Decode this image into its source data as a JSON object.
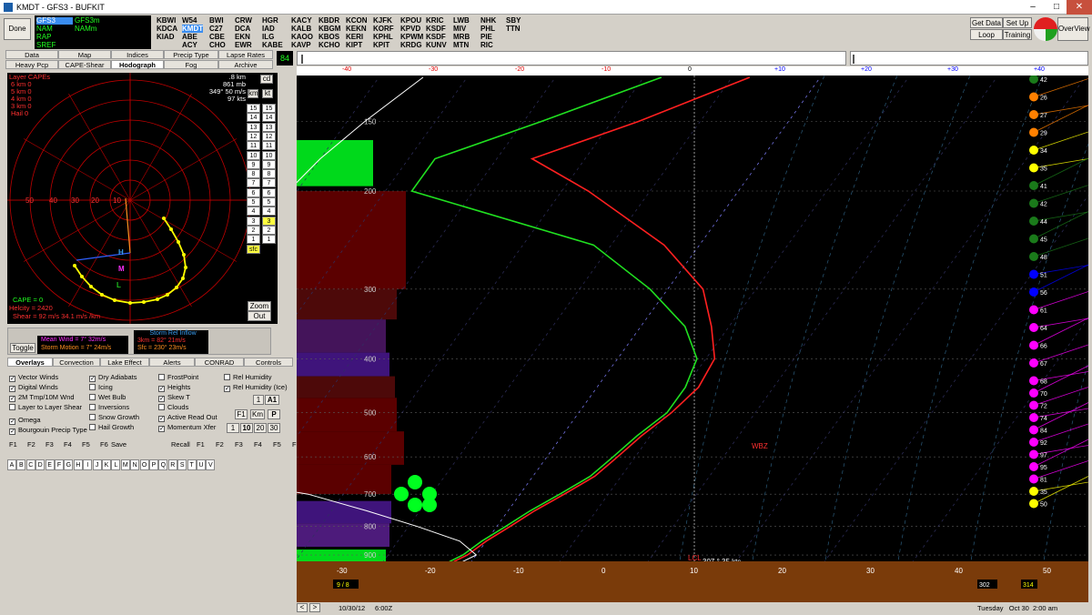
{
  "window": {
    "title": "KMDT - GFS3 - BUFKIT",
    "minimize": "–",
    "maximize": "□",
    "close": "✕"
  },
  "toolbar": {
    "done": "Done",
    "get_data": "Get Data",
    "set_up": "Set Up",
    "loop": "Loop",
    "training": "Training",
    "overview": "OverView"
  },
  "models": {
    "col1": [
      "GFS3",
      "NAM",
      "RAP",
      "SREF"
    ],
    "col2": [
      "GFS3m",
      "NAMm"
    ],
    "selected": "GFS3"
  },
  "stations": {
    "row1": [
      "KBWI",
      "W54",
      "BWI",
      "CRW",
      "HGR",
      "KACY",
      "KBDR",
      "KCON",
      "KJFK",
      "KPOU",
      "KRIC",
      "LWB",
      "NHK",
      "SBY"
    ],
    "row2": [
      "KDCA",
      "KMDT",
      "C27",
      "DCA",
      "IAD",
      "KALB",
      "KBGM",
      "KEKN",
      "KORF",
      "KPVD",
      "KSDF",
      "MIV",
      "PHL",
      "TTN"
    ],
    "row3": [
      "KIAD",
      "ABE",
      "CBE",
      "EKN",
      "ILG",
      "KAOO",
      "KBOS",
      "KERI",
      "KPHL",
      "KPWM",
      "KSDF",
      "MRB",
      "PIE",
      ""
    ],
    "row4": [
      "",
      "ACY",
      "CHO",
      "EWR",
      "KABE",
      "KAVP",
      "KCHO",
      "KIPT",
      "KPIT",
      "KRDG",
      "KUNV",
      "MTN",
      "RIC",
      ""
    ]
  },
  "tabs_row1": [
    "Data",
    "Map",
    "Indices",
    "Precip Type",
    "Lapse Rates"
  ],
  "tabs_row2": [
    "Heavy Pcp",
    "CAPE-Shear",
    "Hodograph",
    "Fog",
    "Archive"
  ],
  "frame_box": "84",
  "hodograph": {
    "layer_capes": [
      "Layer CAPEs",
      "6 km  0",
      "5 km  0",
      "4 km  0",
      "3 km  0",
      "Hail  0"
    ],
    "readout": [
      ".8 km",
      "861 mb",
      "349° 50 m/s",
      "97 kts"
    ],
    "ring_labels": [
      "50",
      "40",
      "30",
      "20",
      "10"
    ],
    "cape": "CAPE = 0",
    "helicity": "Helcity = 2420",
    "shear": "Shear = 92 m/s  34.1 m/s /km",
    "markers": {
      "h": "H",
      "m": "M",
      "l": "L"
    },
    "small_btns": [
      "cd",
      "km",
      "kt"
    ],
    "layers_left": [
      "15",
      "14",
      "13",
      "12",
      "11",
      "10",
      "9",
      "8",
      "7",
      "6",
      "5",
      "4",
      "3",
      "2",
      "1",
      "sfc"
    ],
    "layers_right": [
      "15",
      "14",
      "13",
      "12",
      "11",
      "10",
      "9",
      "8",
      "7",
      "6",
      "5",
      "4",
      "3",
      "2",
      "1"
    ],
    "zoom": "Zoom",
    "out": "Out"
  },
  "storm": {
    "toggle": "Toggle",
    "mean_wind": "Mean Wind = 7°  32m/s",
    "storm_motion": "Storm Motion = 7°  24m/s",
    "rel_inflow_title": "Storm Rel Inflow",
    "rel_3km": "3km = 82°  21m/s",
    "rel_sfc": "Sfc = 230°  23m/s"
  },
  "panel_tabs1": [
    "Overlays",
    "Convection",
    "Lake Effect",
    "Alerts",
    "CONRAD",
    "Controls"
  ],
  "overlays": {
    "col1": [
      "Vector Winds",
      "Digital Winds",
      "2M Tmp/10M Wnd",
      "Layer to Layer Shear",
      "Omega",
      "Bourgouin Precip Type"
    ],
    "col1_checked": [
      true,
      true,
      true,
      false,
      true,
      true
    ],
    "col2": [
      "Dry Adiabats",
      "Icing",
      "Wet Bulb",
      "Inversions",
      "Snow Growth",
      "Hail Growth"
    ],
    "col2_checked": [
      true,
      false,
      false,
      false,
      false,
      false
    ],
    "col3": [
      "FrostPoint",
      "Heights",
      "Skew T",
      "Clouds",
      "Active Read Out",
      "Momentum Xfer"
    ],
    "col3_checked": [
      false,
      true,
      true,
      false,
      true,
      true
    ],
    "col4": [
      "Rel Humidity",
      "Rel Humidity (Ice)"
    ],
    "col4_checked": [
      false,
      true
    ],
    "btns_a": [
      "1",
      "A1"
    ],
    "btns_b": [
      "F1",
      "Km",
      "P"
    ],
    "btns_c": [
      "1",
      "10",
      "20",
      "30"
    ]
  },
  "fkeys_left": [
    "F1",
    "F2",
    "F3",
    "F4",
    "F5",
    "F6"
  ],
  "save": "Save",
  "recall": "Recall",
  "fkeys_right": [
    "F1",
    "F2",
    "F3",
    "F4",
    "F5",
    "F6"
  ],
  "letters": [
    "A",
    "B",
    "C",
    "D",
    "E",
    "F",
    "G",
    "H",
    "I",
    "J",
    "K",
    "L",
    "M",
    "N",
    "O",
    "P",
    "Q",
    "R",
    "S",
    "T",
    "U",
    "V"
  ],
  "skewt": {
    "top_ticks": [
      "-40",
      "-30",
      "-20",
      "-10",
      "0",
      "+10",
      "+20",
      "+30",
      "+40"
    ],
    "pressure_labels": [
      "150",
      "200",
      "300",
      "400",
      "500",
      "600",
      "700",
      "800",
      "900"
    ],
    "bottom_ticks": [
      "-30",
      "-20",
      "-10",
      "0",
      "10",
      "20",
      "30",
      "40",
      "50"
    ],
    "wbz": "WBZ",
    "lcl": "LCL",
    "surface_wind": "307 ° 35 kts",
    "left_box": "9 / 8",
    "right_box": "302",
    "right_box2": "314",
    "wind_speeds": [
      "42",
      "26",
      "27",
      "29",
      "34",
      "35",
      "41",
      "42",
      "44",
      "45",
      "48",
      "51",
      "56",
      "61",
      "64",
      "66",
      "67",
      "68",
      "70",
      "72",
      "74",
      "84",
      "92",
      "97",
      "95",
      "81",
      "35",
      "50"
    ],
    "wind_colors": [
      "#1a7a1a",
      "#ff8000",
      "#ff8000",
      "#ff8000",
      "#ffff00",
      "#ffff00",
      "#1a7a1a",
      "#1a7a1a",
      "#1a7a1a",
      "#1a7a1a",
      "#1a7a1a",
      "#0000ff",
      "#0000ff",
      "#ff00ff",
      "#ff00ff",
      "#ff00ff",
      "#ff00ff",
      "#ff00ff",
      "#ff00ff",
      "#ff00ff",
      "#ff00ff",
      "#ff00ff",
      "#ff00ff",
      "#ff00ff",
      "#ff00ff",
      "#ff00ff",
      "#ffff00",
      "#ffff00"
    ],
    "series": [
      {
        "name": "",
        "color": "#ff2020",
        "p": [
          125,
          150,
          175,
          200,
          250,
          300,
          350,
          400,
          450,
          500,
          550,
          600,
          650,
          700,
          750,
          800,
          850,
          900,
          925
        ],
        "t": [
          -8,
          -17,
          -26,
          -17,
          -4,
          4,
          8,
          11,
          11.5,
          10.5,
          9,
          8,
          7,
          5,
          3,
          1.5,
          0,
          -1,
          -2
        ]
      },
      {
        "name": "",
        "color": "#20e020",
        "p": [
          125,
          150,
          175,
          200,
          250,
          300,
          350,
          400,
          450,
          500,
          550,
          600,
          650,
          700,
          750,
          800,
          850,
          900,
          925
        ],
        "t": [
          -18,
          -28,
          -37,
          -37,
          -12,
          -2,
          5,
          9,
          10,
          10,
          8.5,
          7.5,
          6.5,
          4.5,
          2.5,
          1,
          -0.5,
          -1.5,
          -2.5
        ]
      },
      {
        "name": "",
        "color": "#ffffff",
        "p": [
          125,
          150,
          175,
          200,
          250,
          300,
          350,
          400,
          450,
          500,
          550,
          600,
          650,
          700,
          750,
          800,
          850,
          900,
          925
        ],
        "t": [
          -45,
          -48,
          -50,
          -51,
          -56,
          -56,
          -59,
          -60,
          -62,
          -61,
          -57,
          -48,
          -38,
          -24,
          -16,
          -9,
          -3,
          0,
          -1
        ]
      }
    ]
  },
  "status": {
    "date": "10/30/12",
    "time": "6:00Z",
    "right": "Tuesday   Oct 30  2:00 am"
  }
}
